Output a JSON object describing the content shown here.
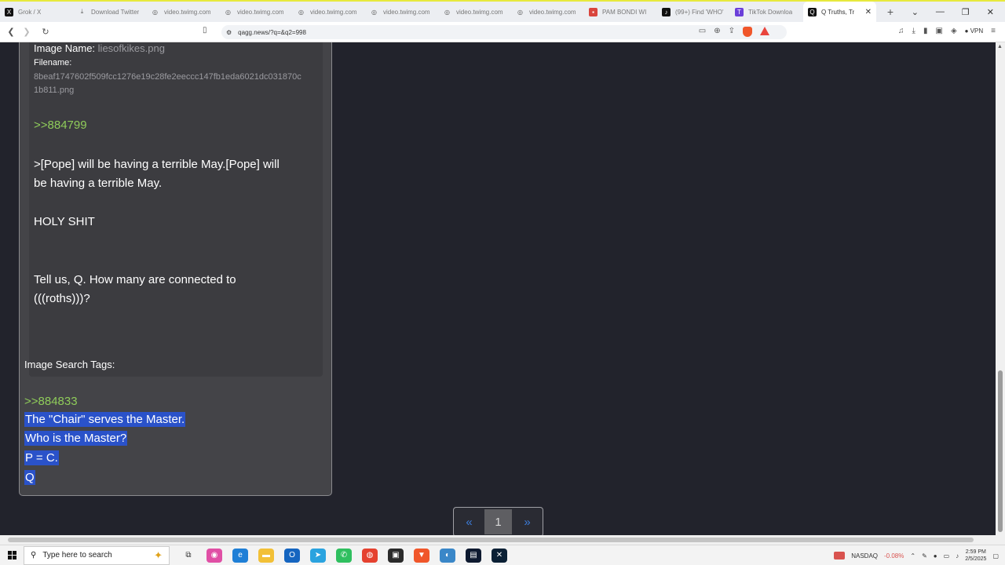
{
  "browser": {
    "tabs": [
      {
        "title": "Grok / X",
        "icon": "x-icon",
        "color": "#111111"
      },
      {
        "title": "Download Twitter",
        "icon": "download-icon",
        "color": "#666666"
      },
      {
        "title": "video.twimg.com",
        "icon": "globe-icon",
        "color": "#555555"
      },
      {
        "title": "video.twimg.com",
        "icon": "globe-icon",
        "color": "#555555"
      },
      {
        "title": "video.twimg.com",
        "icon": "globe-icon",
        "color": "#555555"
      },
      {
        "title": "video.twimg.com",
        "icon": "globe-icon",
        "color": "#555555"
      },
      {
        "title": "video.twimg.com",
        "icon": "globe-icon",
        "color": "#555555"
      },
      {
        "title": "video.twimg.com",
        "icon": "globe-icon",
        "color": "#555555"
      },
      {
        "title": "PAM BONDI WI",
        "icon": "red-icon",
        "color": "#d9453d"
      },
      {
        "title": "(99+) Find 'WHO'",
        "icon": "tiktok-icon",
        "color": "#111111"
      },
      {
        "title": "TikTok Downloa",
        "icon": "purple-icon",
        "color": "#6b3fd9"
      },
      {
        "title": "Q Truths, Tr",
        "icon": "q-icon",
        "color": "#111111",
        "active": true
      }
    ],
    "url": "qagg.news/?q=&q2=998",
    "vpn_label": "VPN"
  },
  "post": {
    "image_name_label": "Image Name:",
    "image_name_value": "liesofkikes.png",
    "filename_label": "Filename:",
    "filename_line1": "8beaf1747602f509fcc1276e19c28fe2eeccc147fb1eda6021dc031870c",
    "filename_line2": "1b811.png",
    "ref1": ">>884799",
    "body_line1": ">[Pope] will be having a terrible May.[Pope] will",
    "body_line2": "be having a terrible May.",
    "body_line3": "HOLY SHIT",
    "body_line4": "Tell us, Q. How many are connected to",
    "body_line5": "(((roths)))?",
    "tags_label": "Image Search Tags:",
    "ref2": ">>884833",
    "answer_line1": "The \"Chair\" serves the Master.",
    "answer_line2": "Who is the Master?",
    "answer_line3": "P = C.",
    "answer_line4": "Q"
  },
  "pagination": {
    "prev": "«",
    "current": "1",
    "next": "»"
  },
  "taskbar": {
    "search_placeholder": "Type here to search",
    "ticker_name": "NASDAQ",
    "ticker_change": "-0.08%",
    "time": "2:59 PM",
    "date": "2/5/2025",
    "colors": {
      "accent": "#2a52c9",
      "positive_ref": "#8fcc5a",
      "negative": "#d9534f"
    }
  }
}
